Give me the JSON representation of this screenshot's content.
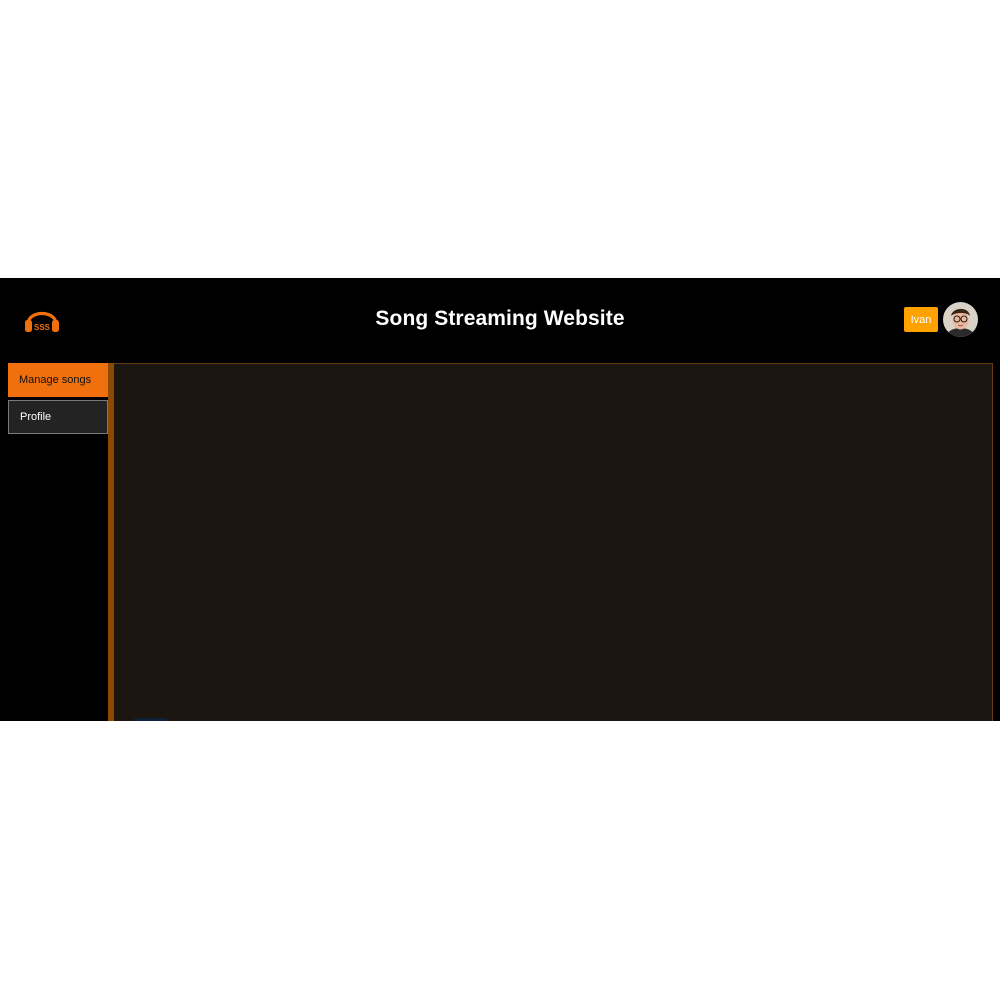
{
  "header": {
    "title": "Song Streaming Website",
    "logo_icon": "headphones-icon",
    "logo_text": "SSS",
    "user_name": "Ivan",
    "avatar_icon": "user-avatar"
  },
  "sidebar": {
    "items": [
      {
        "label": "Manage songs",
        "active": true
      },
      {
        "label": "Profile",
        "active": false
      }
    ]
  },
  "colors": {
    "accent": "#f0700d",
    "badge": "#ffa200",
    "background": "#000000",
    "panel": "#1b1710"
  }
}
